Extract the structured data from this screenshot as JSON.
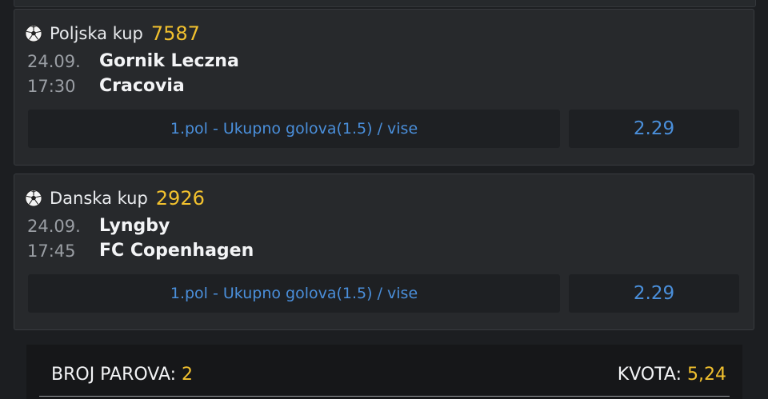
{
  "matches": [
    {
      "league": "Poljska kup",
      "code": "7587",
      "date": "24.09.",
      "time": "17:30",
      "home": "Gornik Leczna",
      "away": "Cracovia",
      "bet": "1.pol - Ukupno golova(1.5) / vise",
      "odds": "2.29",
      "icon": "soccer-ball-icon"
    },
    {
      "league": "Danska kup",
      "code": "2926",
      "date": "24.09.",
      "time": "17:45",
      "home": "Lyngby",
      "away": "FC Copenhagen",
      "bet": "1.pol - Ukupno golova(1.5) / vise",
      "odds": "2.29",
      "icon": "soccer-ball-icon"
    }
  ],
  "summary": {
    "pairs_label": "BROJ PAROVA:",
    "pairs_value": "2",
    "odds_label": "KVOTA:",
    "odds_value": "5,24"
  },
  "colors": {
    "accent_yellow": "#f2c12e",
    "link_blue": "#4a8fdb",
    "card_bg": "#27292c",
    "page_bg": "#1c1e21"
  }
}
